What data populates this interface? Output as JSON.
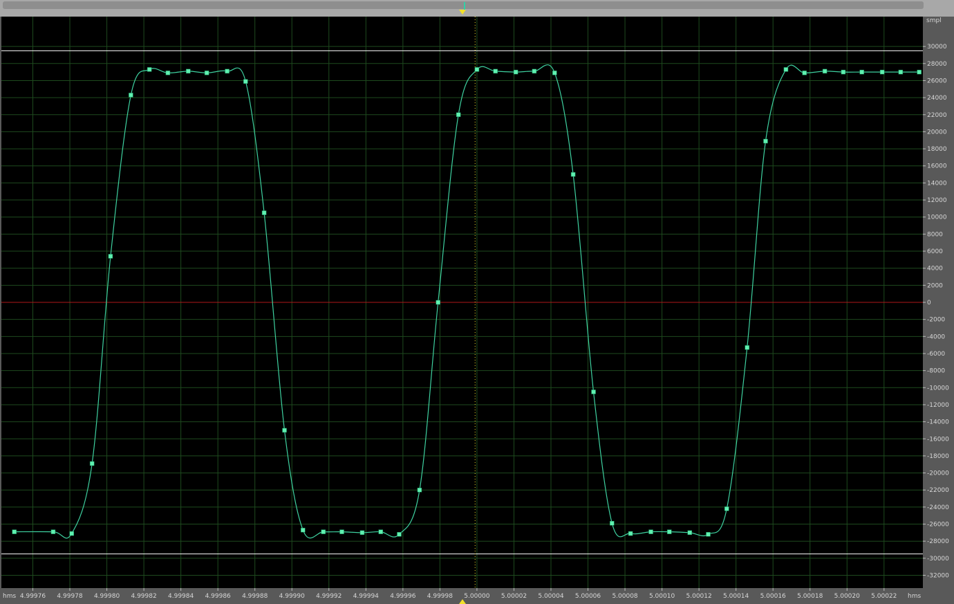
{
  "y_unit_label": "smpl",
  "x_unit_label": "hms",
  "colors": {
    "background": "#000000",
    "grid": "#1e4a1e",
    "waveform": "#3ed1a0",
    "sample_marker": "#5ff0b0",
    "zero_line": "#b0181a",
    "clip_lines": "#ffffff",
    "cursor": "#f2e02a"
  },
  "cursor": {
    "time": 4.999999
  },
  "chart_data": {
    "type": "line",
    "xlabel": "hms",
    "ylabel": "smpl",
    "xlim": [
      4.999743,
      5.000241
    ],
    "ylim": [
      -33500,
      33500
    ],
    "clip_levels": [
      29500,
      -29500
    ],
    "grid": true,
    "y_ticks": [
      30000,
      28000,
      26000,
      24000,
      22000,
      20000,
      18000,
      16000,
      14000,
      12000,
      10000,
      8000,
      6000,
      4000,
      2000,
      0,
      -2000,
      -4000,
      -6000,
      -8000,
      -10000,
      -12000,
      -14000,
      -16000,
      -18000,
      -20000,
      -22000,
      -24000,
      -26000,
      -28000,
      -30000,
      -32000
    ],
    "x_tick_labels": [
      "4.99976",
      "4.99978",
      "4.99980",
      "4.99982",
      "4.99984",
      "4.99986",
      "4.99988",
      "4.99990",
      "4.99992",
      "4.99994",
      "4.99996",
      "4.99998",
      "5.00000",
      "5.00002",
      "5.00004",
      "5.00006",
      "5.00008",
      "5.00010",
      "5.00012",
      "5.00014",
      "5.00016",
      "5.00018",
      "5.00020",
      "5.00022"
    ],
    "x_ticks": [
      4.99976,
      4.99978,
      4.9998,
      4.99982,
      4.99984,
      4.99986,
      4.99988,
      4.9999,
      4.99992,
      4.99994,
      4.99996,
      4.99998,
      5.0,
      5.00002,
      5.00004,
      5.00006,
      5.00008,
      5.0001,
      5.00012,
      5.00014,
      5.00016,
      5.00018,
      5.0002,
      5.00022
    ],
    "series": [
      {
        "x": [
          4.99975,
          4.999771,
          4.999781,
          4.999792,
          4.999802,
          4.999813,
          4.999823,
          4.999833,
          4.999844,
          4.999854,
          4.999865,
          4.999875,
          4.999885,
          4.999896,
          4.999906,
          4.999917,
          4.999927,
          4.999938,
          4.999948,
          4.999958,
          4.999969,
          4.999979,
          4.99999,
          5.0,
          5.00001,
          5.000021,
          5.000031,
          5.000042,
          5.000052,
          5.000063,
          5.000073,
          5.000083,
          5.000094,
          5.000104,
          5.000115,
          5.000125,
          5.000135,
          5.000146,
          5.000156,
          5.000167,
          5.000177,
          5.000188,
          5.000198,
          5.000208,
          5.000219,
          5.000229,
          5.000239
        ],
        "y": [
          -26900,
          -26900,
          -27100,
          -18900,
          5400,
          24300,
          27300,
          26900,
          27100,
          26900,
          27100,
          25900,
          10500,
          -15000,
          -26700,
          -26900,
          -26900,
          -27000,
          -26900,
          -27200,
          -22000,
          0,
          22000,
          27300,
          27100,
          27000,
          27100,
          26900,
          15000,
          -10500,
          -25900,
          -27100,
          -26900,
          -26900,
          -27000,
          -27200,
          -24200,
          -5300,
          18900,
          27300,
          26900,
          27100,
          27000,
          27000,
          27000,
          27000,
          27000
        ]
      }
    ]
  }
}
